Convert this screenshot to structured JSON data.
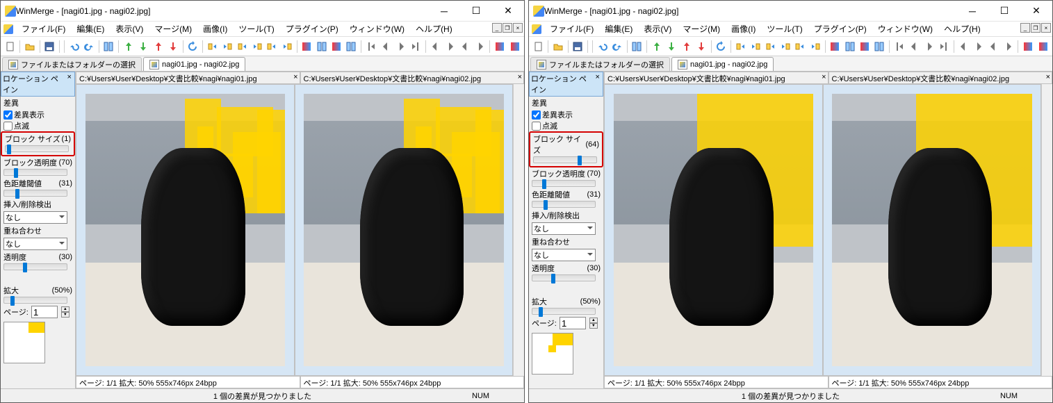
{
  "left": {
    "title": "WinMerge - [nagi01.jpg - nagi02.jpg]",
    "menus": {
      "file": "ファイル(F)",
      "edit": "編集(E)",
      "view": "表示(V)",
      "merge": "マージ(M)",
      "image": "画像(I)",
      "tools": "ツール(T)",
      "plugins": "プラグイン(P)",
      "window": "ウィンドウ(W)",
      "help": "ヘルプ(H)"
    },
    "tabs": {
      "select": "ファイルまたはフォルダーの選択",
      "compare": "nagi01.jpg - nagi02.jpg"
    },
    "side": {
      "header": "ロケーション ペイン",
      "diff": "差異",
      "show_diff": "差異表示",
      "show_diff_checked": true,
      "blink": "点滅",
      "blink_checked": false,
      "block_size": "ブロック サイズ",
      "block_size_val": "(1)",
      "block_slider_pct": 2,
      "block_alpha": "ブロック透明度",
      "block_alpha_val": "(70)",
      "alpha_slider_pct": 15,
      "color_dist": "色距離閾値",
      "color_dist_val": "(31)",
      "dist_slider_pct": 18,
      "ins_del": "挿入/削除検出",
      "ins_del_sel": "なし",
      "overlay": "重ね合わせ",
      "overlay_sel": "なし",
      "transparency": "透明度",
      "transparency_val": "(30)",
      "trans_slider_pct": 30,
      "zoom": "拡大",
      "zoom_val": "(50%)",
      "zoom_slider_pct": 10,
      "page": "ページ:",
      "page_val": "1"
    },
    "paths": {
      "p1": "C:¥Users¥User¥Desktop¥文書比較¥nagi¥nagi01.jpg",
      "p2": "C:¥Users¥User¥Desktop¥文書比較¥nagi¥nagi02.jpg"
    },
    "info": "ページ: 1/1  拡大: 50%  555x746px  24bpp",
    "status_center": "1 個の差異が見つかりました",
    "status_num": "NUM",
    "highlight_style": "fine"
  },
  "right": {
    "title": "WinMerge - [nagi01.jpg - nagi02.jpg]",
    "menus": {
      "file": "ファイル(F)",
      "edit": "編集(E)",
      "view": "表示(V)",
      "merge": "マージ(M)",
      "image": "画像(I)",
      "tools": "ツール(T)",
      "plugins": "プラグイン(P)",
      "window": "ウィンドウ(W)",
      "help": "ヘルプ(H)"
    },
    "tabs": {
      "select": "ファイルまたはフォルダーの選択",
      "compare": "nagi01.jpg - nagi02.jpg"
    },
    "side": {
      "header": "ロケーション ペイン",
      "diff": "差異",
      "show_diff": "差異表示",
      "show_diff_checked": true,
      "blink": "点滅",
      "blink_checked": false,
      "block_size": "ブロック サイズ",
      "block_size_val": "(64)",
      "block_slider_pct": 70,
      "block_alpha": "ブロック透明度",
      "block_alpha_val": "(70)",
      "alpha_slider_pct": 15,
      "color_dist": "色距離閾値",
      "color_dist_val": "(31)",
      "dist_slider_pct": 18,
      "ins_del": "挿入/削除検出",
      "ins_del_sel": "なし",
      "overlay": "重ね合わせ",
      "overlay_sel": "なし",
      "transparency": "透明度",
      "transparency_val": "(30)",
      "trans_slider_pct": 30,
      "zoom": "拡大",
      "zoom_val": "(50%)",
      "zoom_slider_pct": 10,
      "page": "ページ:",
      "page_val": "1"
    },
    "paths": {
      "p1": "C:¥Users¥User¥Desktop¥文書比較¥nagi¥nagi01.jpg",
      "p2": "C:¥Users¥User¥Desktop¥文書比較¥nagi¥nagi02.jpg"
    },
    "info": "ページ: 1/1  拡大: 50%  555x746px  24bpp",
    "status_center": "1 個の差異が見つかりました",
    "status_num": "NUM",
    "highlight_style": "coarse"
  }
}
